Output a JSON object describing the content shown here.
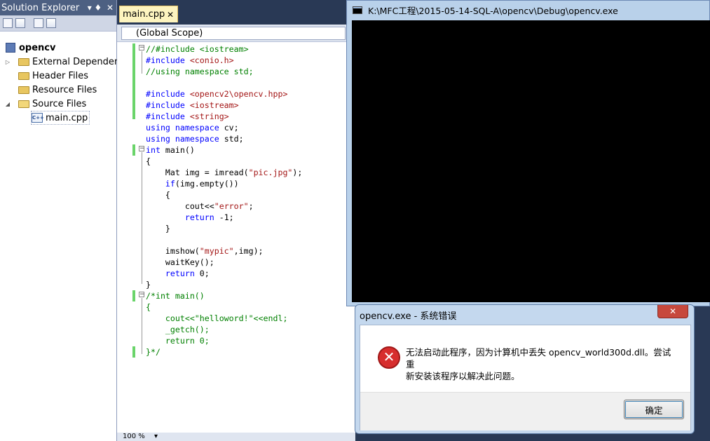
{
  "solution_explorer": {
    "title": "Solution Explorer",
    "pin_glyph": "▾ ♦",
    "close_glyph": "✕",
    "items": [
      {
        "label": "opencv",
        "icon": "solution-icon",
        "level": 0
      },
      {
        "label": "External Dependencies",
        "icon": "folder-icon",
        "level": 1
      },
      {
        "label": "Header Files",
        "icon": "folder-icon",
        "level": 1
      },
      {
        "label": "Resource Files",
        "icon": "folder-icon",
        "level": 1
      },
      {
        "label": "Source Files",
        "icon": "folder-open-icon",
        "level": 1
      },
      {
        "label": "main.cpp",
        "icon": "cpp-file-icon",
        "level": 2
      }
    ]
  },
  "editor": {
    "tab_label": "main.cpp",
    "tab_close": "✕",
    "scope": "(Global Scope)",
    "zoom": "100 %",
    "code_lines": [
      "//#include <iostream>",
      "#include <conio.h>",
      "//using namespace std;",
      "",
      "#include <opencv2\\opencv.hpp>",
      "#include <iostream>",
      "#include <string>",
      "using namespace cv;",
      "using namespace std;",
      "int main()",
      "{",
      "    Mat img = imread(\"pic.jpg\");",
      "    if(img.empty())",
      "    {",
      "        cout<<\"error\";",
      "        return -1;",
      "    }",
      "",
      "    imshow(\"mypic\",img);",
      "    waitKey();",
      "    return 0;",
      "}",
      "/*int main()",
      "{",
      "    cout<<\"helloword!\"<<endl;",
      "    _getch();",
      "    return 0;",
      "}*/"
    ]
  },
  "console": {
    "title": "K:\\MFC工程\\2015-05-14-SQL-A\\opencv\\Debug\\opencv.exe",
    "background": "#000000"
  },
  "dialog": {
    "title": "opencv.exe - 系统错误",
    "close_glyph": "✕",
    "message_line1": "无法启动此程序，因为计算机中丢失 opencv_world300d.dll。尝试重",
    "message_line2": "新安装该程序以解决此问题。",
    "ok_label": "确定",
    "error_glyph": "✕"
  },
  "colors": {
    "ide_frame": "#293955",
    "keyword": "#0000ff",
    "comment": "#008000",
    "string": "#a31515",
    "change_bar": "#6ad46a",
    "dialog_close": "#c7483c"
  }
}
